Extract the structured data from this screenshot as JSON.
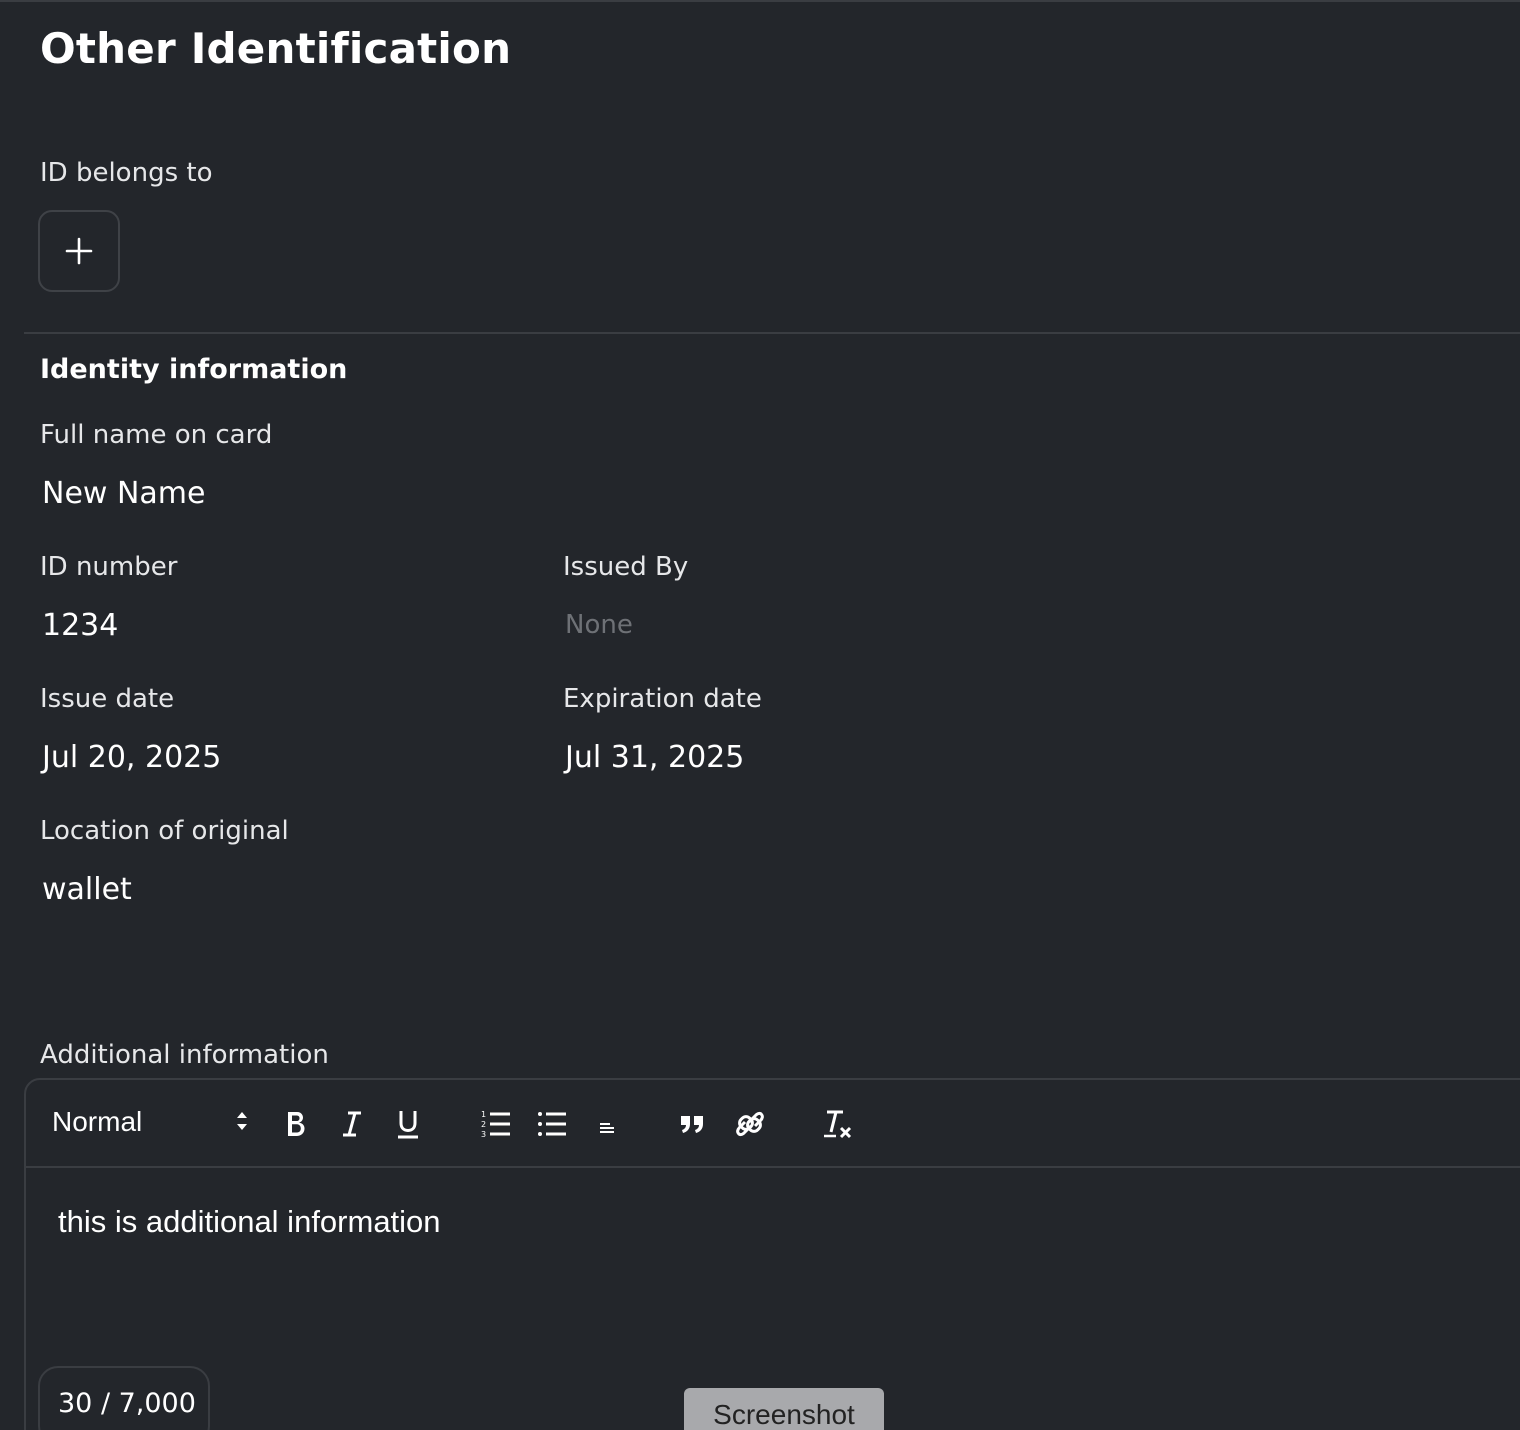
{
  "header": {
    "title": "Other Identification"
  },
  "owner": {
    "label": "ID belongs to",
    "add_icon": "plus-icon"
  },
  "identity": {
    "heading": "Identity information",
    "full_name": {
      "label": "Full name on card",
      "value": "New Name"
    },
    "id_number": {
      "label": "ID number",
      "value": "1234"
    },
    "issued_by": {
      "label": "Issued By",
      "placeholder": "None"
    },
    "issue_date": {
      "label": "Issue date",
      "value": "Jul 20, 2025"
    },
    "expiration_date": {
      "label": "Expiration date",
      "value": "Jul 31, 2025"
    },
    "location": {
      "label": "Location of original",
      "value": "wallet"
    }
  },
  "additional": {
    "label": "Additional information",
    "toolbar": {
      "format_value": "Normal",
      "icons": [
        "bold-icon",
        "italic-icon",
        "underline-icon",
        "ordered-list-icon",
        "bullet-list-icon",
        "align-icon",
        "quote-icon",
        "link-icon",
        "clear-format-icon"
      ]
    },
    "content": "this is additional information",
    "counter": "30 / 7,000"
  },
  "overlay": {
    "screenshot_label": "Screenshot"
  }
}
